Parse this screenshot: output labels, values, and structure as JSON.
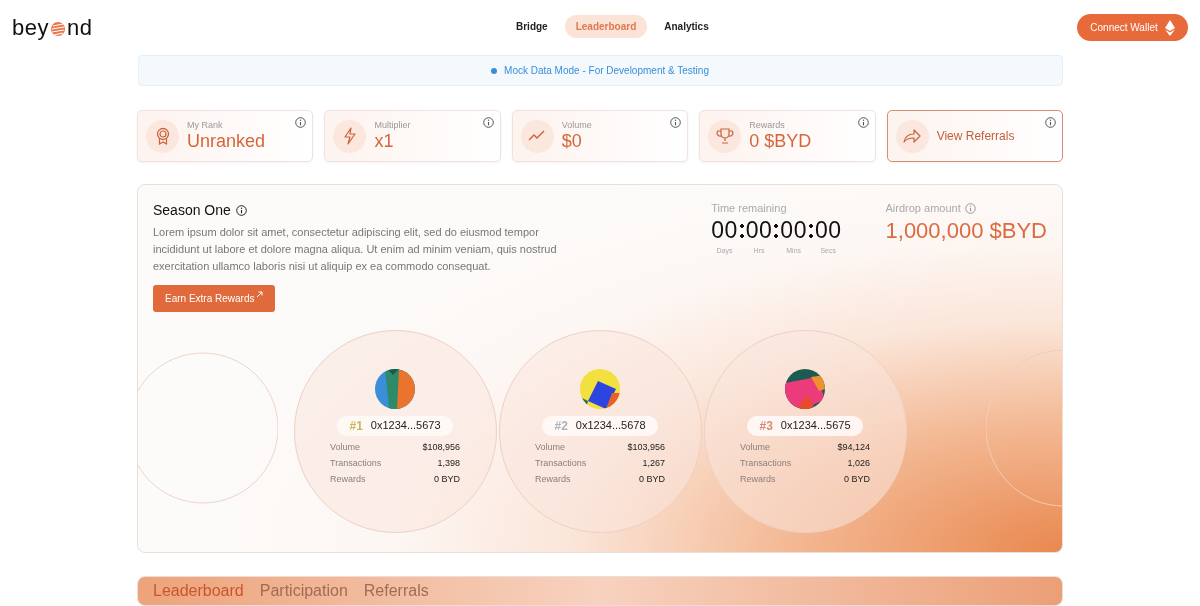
{
  "header": {
    "logo": {
      "text_before": "bey",
      "text_after": "nd"
    },
    "nav": [
      {
        "label": "Bridge",
        "selected": false
      },
      {
        "label": "Leaderboard",
        "selected": true
      },
      {
        "label": "Analytics",
        "selected": false
      }
    ],
    "connect_button": "Connect Wallet"
  },
  "banner": "Mock Data Mode - For Development & Testing",
  "stat_cards": [
    {
      "kind": "stat",
      "label": "My Rank",
      "value": "Unranked"
    },
    {
      "kind": "stat",
      "label": "Multiplier",
      "value": "x1"
    },
    {
      "kind": "stat",
      "label": "Volume",
      "value": "$0"
    },
    {
      "kind": "stat",
      "label": "Rewards",
      "value": "0 $BYD"
    },
    {
      "kind": "link",
      "label": "View Referrals"
    }
  ],
  "season": {
    "title": "Season One",
    "description": "Lorem ipsum dolor sit amet, consectetur adipiscing elit, sed do eiusmod tempor incididunt ut labore et dolore magna aliqua. Ut enim ad minim veniam, quis nostrud exercitation ullamco laboris nisi ut aliquip ex ea commodo consequat.",
    "button": "Earn Extra Rewards",
    "time_label": "Time remaining",
    "countdown": [
      {
        "value": "00",
        "unit": "Days"
      },
      {
        "value": "00",
        "unit": "Hrs"
      },
      {
        "value": "00",
        "unit": "Mins"
      },
      {
        "value": "00",
        "unit": "Secs"
      }
    ],
    "airdrop_label": "Airdrop amount",
    "airdrop_value": "1,000,000 $BYD",
    "podium": [
      {
        "rank": "#1",
        "color": "#c9b85a",
        "address": "0x1234...5673",
        "stats": [
          {
            "label": "Volume",
            "value": "$108,956"
          },
          {
            "label": "Transactions",
            "value": "1,398"
          },
          {
            "label": "Rewards",
            "value": "0 BYD"
          }
        ]
      },
      {
        "rank": "#2",
        "color": "#a9b4c0",
        "address": "0x1234...5678",
        "stats": [
          {
            "label": "Volume",
            "value": "$103,956"
          },
          {
            "label": "Transactions",
            "value": "1,267"
          },
          {
            "label": "Rewards",
            "value": "0 BYD"
          }
        ]
      },
      {
        "rank": "#3",
        "color": "#d88a78",
        "address": "0x1234...5675",
        "stats": [
          {
            "label": "Volume",
            "value": "$94,124"
          },
          {
            "label": "Transactions",
            "value": "1,026"
          },
          {
            "label": "Rewards",
            "value": "0 BYD"
          }
        ]
      }
    ]
  },
  "tabs": [
    {
      "label": "Leaderboard",
      "selected": true
    },
    {
      "label": "Participation",
      "selected": false
    },
    {
      "label": "Referrals",
      "selected": false
    }
  ]
}
